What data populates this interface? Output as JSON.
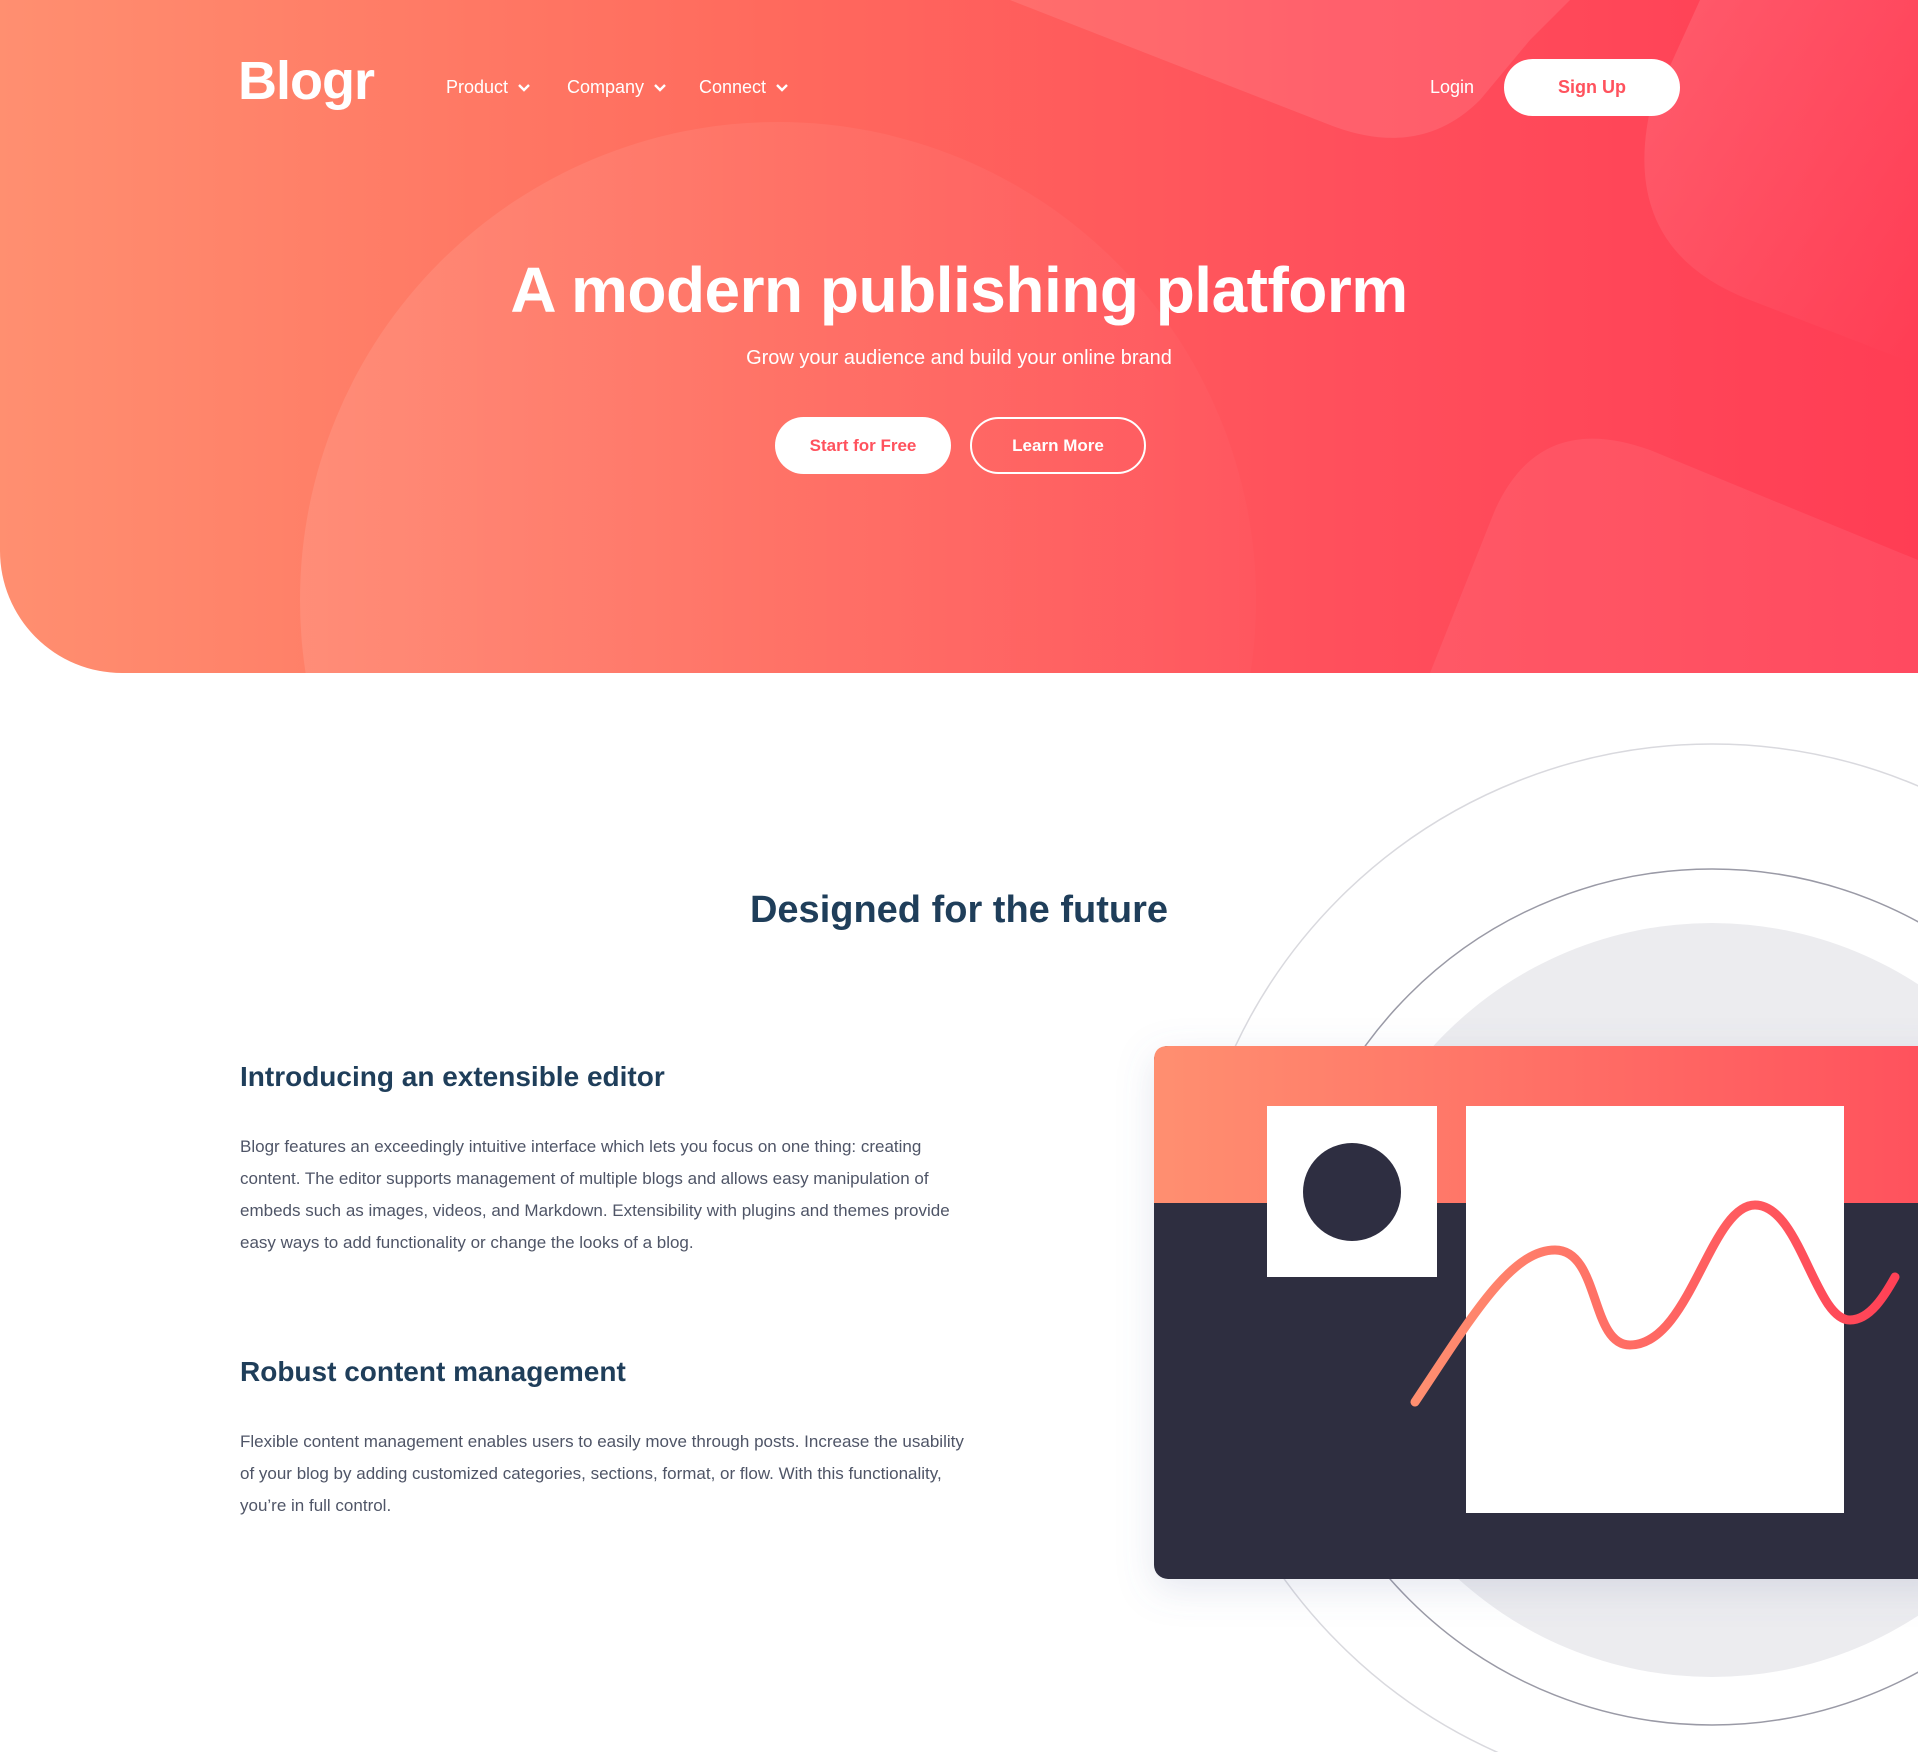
{
  "colors": {
    "brand": "#ff525d",
    "heading": "#1f3e5a",
    "body_text": "#4f5567",
    "dark_panel": "#2e2e41"
  },
  "nav": {
    "logo": "Blogr",
    "items": [
      {
        "label": "Product",
        "icon": "chevron-down-icon"
      },
      {
        "label": "Company",
        "icon": "chevron-down-icon"
      },
      {
        "label": "Connect",
        "icon": "chevron-down-icon"
      }
    ],
    "login_label": "Login",
    "signup_label": "Sign Up"
  },
  "hero": {
    "title": "A modern publishing platform",
    "subtitle": "Grow your audience and build your online brand",
    "primary_cta": "Start for Free",
    "secondary_cta": "Learn More"
  },
  "features": {
    "section_title": "Designed for the future",
    "items": [
      {
        "heading": "Introducing an extensible editor",
        "text": "Blogr features an exceedingly intuitive interface which lets you focus on one thing: creating content. The editor supports management of multiple blogs and allows easy manipulation of embeds such as images, videos, and Markdown. Extensibility with plugins and themes provide easy ways to add functionality or change the looks of a blog."
      },
      {
        "heading": "Robust content management",
        "text": "Flexible content management enables users to easily move through posts. Increase the usability of your blog by adding customized categories, sections, format, or flow. With this functionality, you’re in full control."
      }
    ]
  }
}
